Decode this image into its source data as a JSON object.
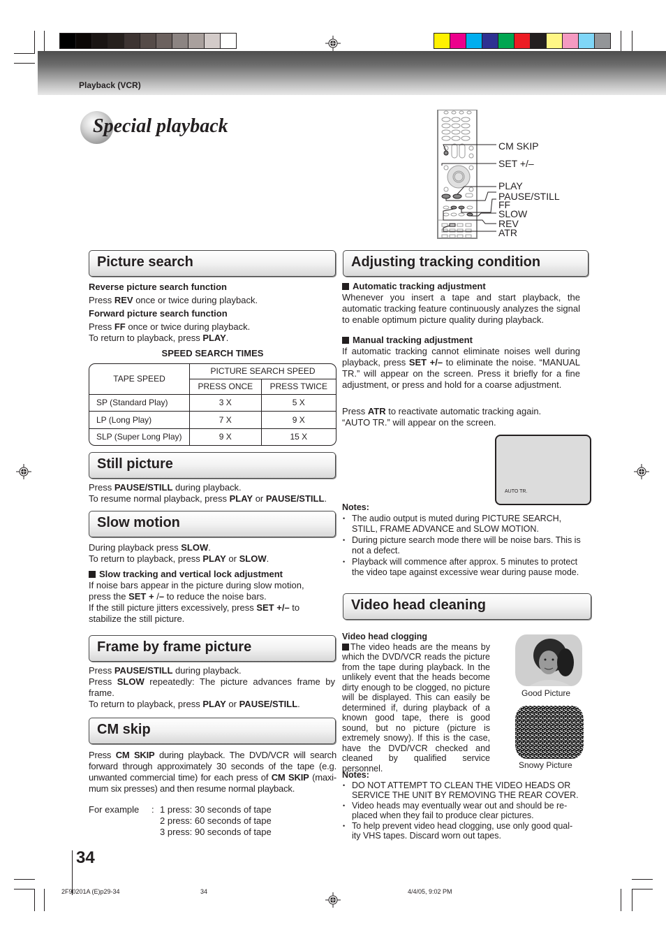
{
  "header": {
    "section_label": "Playback (VCR)",
    "gray_swatches": [
      "#000000",
      "#0b0705",
      "#1a1513",
      "#26201d",
      "#3d3432",
      "#554b48",
      "#6b615e",
      "#8c8482",
      "#a9a09d",
      "#d3cbc9",
      "#ffffff"
    ],
    "color_swatches": [
      "#fff100",
      "#ec008c",
      "#00aeef",
      "#2e3192",
      "#00a651",
      "#ed1c24",
      "#231f20",
      "#fff685",
      "#f49ac1",
      "#7fd6f7",
      "#939598"
    ]
  },
  "page_title": "Special playback",
  "remote": {
    "labels": [
      "CM SKIP",
      "SET +/–",
      "PLAY",
      "PAUSE/STILL",
      "FF",
      "SLOW",
      "REV",
      "ATR"
    ]
  },
  "picture_search": {
    "heading": "Picture search",
    "reverse_title": "Reverse picture search function",
    "reverse_pre": "Press ",
    "reverse_key": "REV",
    "reverse_post": " once or twice during playback.",
    "forward_title": "Forward picture search function",
    "forward_pre": "Press ",
    "forward_key": "FF",
    "forward_post": " once or twice during playback.",
    "return_pre": "To return to playback, press ",
    "return_key": "PLAY",
    "return_post": ".",
    "table_title": "SPEED SEARCH TIMES",
    "table": {
      "col_tape": "TAPE SPEED",
      "col_group": "PICTURE SEARCH SPEED",
      "col_once": "PRESS ONCE",
      "col_twice": "PRESS TWICE",
      "rows": [
        {
          "tape": "SP (Standard Play)",
          "once": "3 X",
          "twice": "5 X"
        },
        {
          "tape": "LP (Long Play)",
          "once": "7 X",
          "twice": "9 X"
        },
        {
          "tape": "SLP (Super Long Play)",
          "once": "9 X",
          "twice": "15 X"
        }
      ]
    }
  },
  "still_picture": {
    "heading": "Still picture",
    "l1_pre": "Press ",
    "l1_key": "PAUSE/STILL",
    "l1_post": " during playback.",
    "l2_pre": "To resume normal playback, press ",
    "l2_key1": "PLAY",
    "l2_mid": " or ",
    "l2_key2": "PAUSE/STILL",
    "l2_post": "."
  },
  "slow_motion": {
    "heading": "Slow motion",
    "l1_pre": "During playback press ",
    "l1_key": "SLOW",
    "l1_post": ".",
    "l2_pre": "To return to playback, press ",
    "l2_key1": "PLAY",
    "l2_mid": " or ",
    "l2_key2": "SLOW",
    "l2_post": ".",
    "sub_title": "Slow tracking and vertical lock adjustment",
    "p1": "If noise bars appear in the picture during slow motion,",
    "p2_pre": "press the ",
    "p2_key": "SET + ",
    "p2_mid": "/",
    "p2_key2": "–",
    "p2_post": " to reduce the noise bars.",
    "p3_pre": "If the still picture jitters excessively, press ",
    "p3_key": "SET +/–",
    "p3_post": " to",
    "p4": "stabilize the still picture."
  },
  "frame_by_frame": {
    "heading": "Frame by frame picture",
    "l1_pre": "Press ",
    "l1_key": "PAUSE/STILL",
    "l1_post": " during playback.",
    "l2_pre": "Press ",
    "l2_key": "SLOW",
    "l2_post": " repeatedly: The picture advances frame by frame.",
    "l3_pre": "To return to playback, press ",
    "l3_key1": "PLAY",
    "l3_mid": " or ",
    "l3_key2": "PAUSE/STILL",
    "l3_post": "."
  },
  "cm_skip": {
    "heading": "CM skip",
    "p_pre": "Press ",
    "p_key": "CM SKIP",
    "p_mid": " during playback. The DVD/VCR will search forward through approximately 30 seconds of the tape (e.g. unwanted commercial time) for each press of ",
    "p_key2": "CM SKIP",
    "p_post": " (maxi-mum six presses) and then resume normal playback.",
    "example_label": "For example",
    "example_sep": ":",
    "examples": [
      "1 press: 30 seconds of tape",
      "2 press: 60 seconds of tape",
      "3 press: 90 seconds of tape"
    ]
  },
  "tracking": {
    "heading": "Adjusting tracking condition",
    "auto_title": "Automatic tracking adjustment",
    "auto_text": "Whenever you insert a tape and start playback, the automatic tracking feature continuously analyzes the signal to enable optimum picture quality during playback.",
    "manual_title": "Manual tracking adjustment",
    "manual_pre": "If automatic tracking cannot eliminate noises well during playback, press ",
    "manual_key": "SET +/–",
    "manual_post": " to eliminate the noise. “MANUAL TR.” will appear on the screen. Press it briefly for a fine adjustment, or press and hold for a coarse adjustment.",
    "atr_pre": "Press ",
    "atr_key": "ATR",
    "atr_post": " to reactivate automatic tracking again.",
    "atr_l2": "“AUTO TR.” will appear on the screen.",
    "screen_text": "AUTO TR.",
    "notes_title": "Notes:",
    "notes": [
      "The audio output is muted during PICTURE SEARCH, STILL, FRAME ADVANCE and SLOW MOTION.",
      "During picture search mode there will be noise bars. This is not a defect.",
      "Playback will commence after approx. 5 minutes to protect the video tape against excessive wear during pause mode."
    ]
  },
  "head_cleaning": {
    "heading": "Video head cleaning",
    "sub_title": "Video head clogging",
    "text": "The video heads are the means by which the DVD/VCR reads the picture from the tape during playback. In the unlikely event that the heads become dirty enough to be clogged, no picture will be displayed. This can easily be determined if, during playback of a known good tape, there is good sound, but no picture (picture is extremely snowy). If this is the case, have the DVD/VCR checked and cleaned by qualified service personnel.",
    "good_caption": "Good Picture",
    "snowy_caption": "Snowy Picture",
    "notes_title": "Notes:",
    "notes": [
      "DO NOT ATTEMPT TO CLEAN THE VIDEO HEADS OR SERVICE THE UNIT BY REMOVING THE REAR COVER.",
      "Video heads may eventually wear out and should be re-placed when they fail to produce clear pictures.",
      "To help prevent video head clogging, use only good qual-ity VHS tapes. Discard worn out tapes."
    ]
  },
  "footer": {
    "page_number": "34",
    "file_name": "2F90201A (E)p29-34",
    "sheet_number": "34",
    "timestamp": "4/4/05, 9:02 PM"
  }
}
